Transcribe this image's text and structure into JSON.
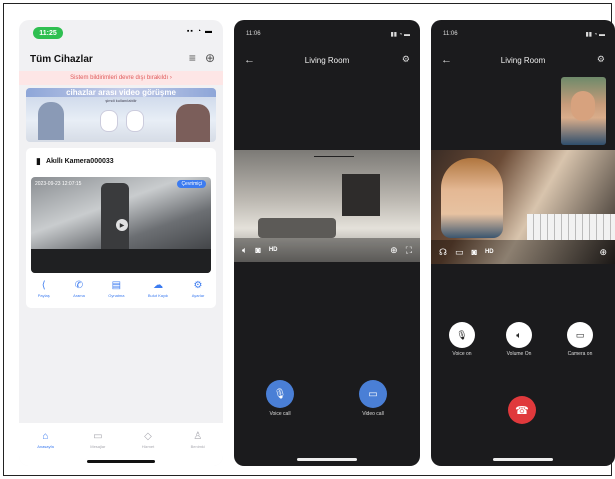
{
  "colors": {
    "accent": "#3d7cf0",
    "status_green": "#2fbf51",
    "call_blue": "#4a7fd6",
    "hangup_red": "#e0393c",
    "notice_bg": "#fde6e6"
  },
  "phone1": {
    "status_time": "11:25",
    "title": "Tüm Cihazlar",
    "notice": "Sistem bildirimleri devre dışı bırakıldı  ›",
    "banner": {
      "title": "cihazlar arası video görüşme",
      "subtitle": "şimdi kullanılabilir"
    },
    "device": {
      "name": "Akıllı Kamera000033",
      "timestamp": "2023-09-23 12:07:15",
      "status": "Çevrimiçi"
    },
    "actions": [
      {
        "label": "Paylaş",
        "icon": "share-icon"
      },
      {
        "label": "Arama",
        "icon": "phone-icon"
      },
      {
        "label": "Oynatma",
        "icon": "playback-icon"
      },
      {
        "label": "Bulut Kaydı",
        "icon": "cloud-icon"
      },
      {
        "label": "Ayarlar",
        "icon": "settings-icon"
      }
    ],
    "tabs": [
      {
        "label": "Anasayfa",
        "icon": "home-icon",
        "active": true
      },
      {
        "label": "Mesajlar",
        "icon": "message-icon",
        "active": false
      },
      {
        "label": "Hizmet",
        "icon": "service-icon",
        "active": false
      },
      {
        "label": "Benimki",
        "icon": "user-icon",
        "active": false
      }
    ]
  },
  "phone2": {
    "status_time": "11:06",
    "title": "Living Room",
    "quality": "HD",
    "calls": [
      {
        "label": "Voice call",
        "icon": "microphone-icon"
      },
      {
        "label": "Video call",
        "icon": "video-camera-icon"
      }
    ]
  },
  "phone3": {
    "status_time": "11:06",
    "title": "Living Room",
    "quality": "HD",
    "controls": [
      {
        "label": "Voice on",
        "icon": "microphone-icon"
      },
      {
        "label": "Volume On",
        "icon": "speaker-icon"
      },
      {
        "label": "Camera on",
        "icon": "video-camera-icon"
      }
    ]
  }
}
